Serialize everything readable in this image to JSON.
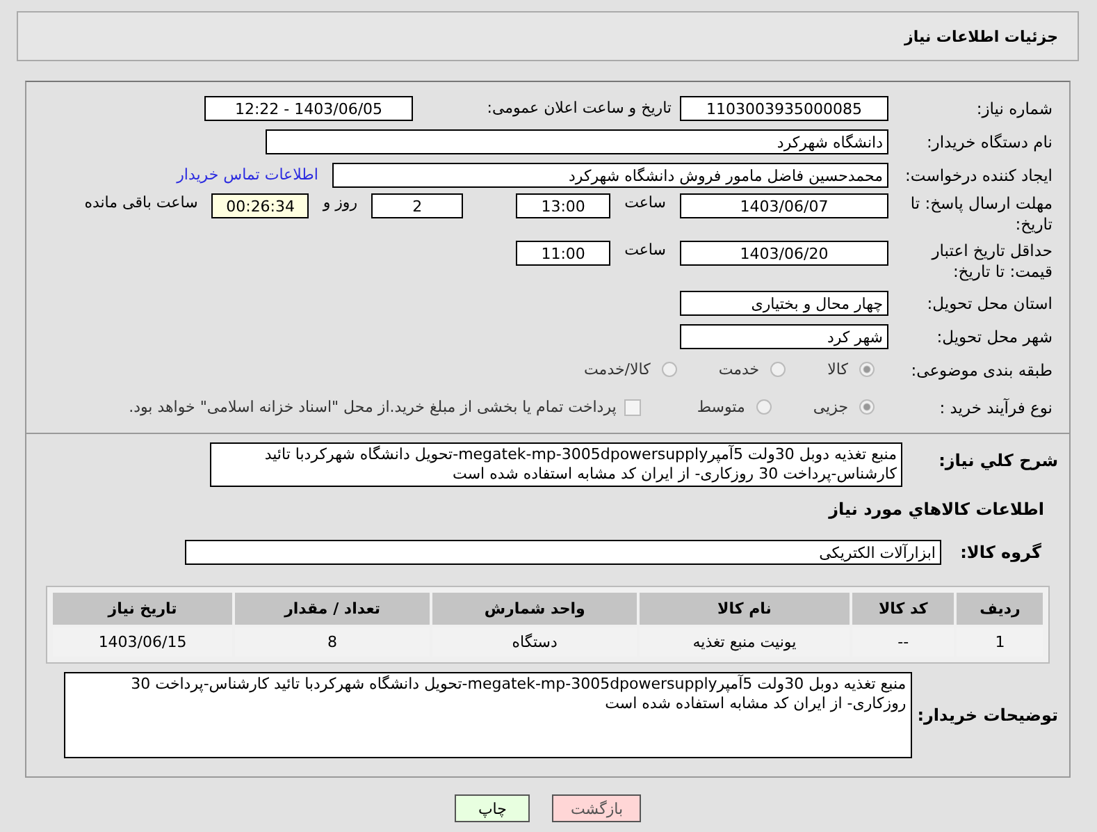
{
  "header": {
    "title": "جزئیات اطلاعات نیاز"
  },
  "need_number": {
    "label": "شماره نیاز:",
    "value": "1103003935000085"
  },
  "announce": {
    "label": "تاریخ و ساعت اعلان عمومی:",
    "value": "1403/06/05 - 12:22"
  },
  "buyer_org": {
    "label": "نام دستگاه خریدار:",
    "value": "دانشگاه شهرکرد"
  },
  "requester": {
    "label": "ایجاد کننده درخواست:",
    "value": "محمدحسین فاضل مامور فروش دانشگاه شهرکرد",
    "link": "اطلاعات تماس خریدار"
  },
  "reply_deadline": {
    "label": "مهلت ارسال پاسخ: تا تاریخ:",
    "date": "1403/06/07",
    "time_label": "ساعت",
    "time": "13:00",
    "days": "2",
    "days_label": "روز و",
    "remaining": "00:26:34",
    "remaining_label": "ساعت باقی مانده"
  },
  "price_validity": {
    "label": "حداقل تاریخ اعتبار قیمت: تا تاریخ:",
    "date": "1403/06/20",
    "time_label": "ساعت",
    "time": "11:00"
  },
  "province": {
    "label": "استان محل تحویل:",
    "value": "چهار محال و بختیاری"
  },
  "city": {
    "label": "شهر محل تحویل:",
    "value": "شهر کرد"
  },
  "category": {
    "label": "طبقه بندی موضوعی:",
    "options": [
      {
        "label": "کالا",
        "selected": true
      },
      {
        "label": "خدمت",
        "selected": false
      },
      {
        "label": "کالا/خدمت",
        "selected": false
      }
    ]
  },
  "process": {
    "label": "نوع فرآیند خرید :",
    "options": [
      {
        "label": "جزیی",
        "selected": true
      },
      {
        "label": "متوسط",
        "selected": false
      }
    ],
    "payment": {
      "label": "پرداخت تمام یا بخشی از مبلغ خرید.از محل \"اسناد خزانه اسلامی\" خواهد بود.",
      "checked": false
    }
  },
  "description": {
    "label": "شرح کلي نیاز:",
    "value": "منبع تغذیه دوبل 30ولت 5آمپرmegatek-mp-3005dpowersupply-تحویل دانشگاه شهرکردبا تائید کارشناس-پرداخت 30 روزکاری- از ایران کد مشابه استفاده شده است"
  },
  "goods_heading": "اطلاعات کالاهاي مورد نياز",
  "goods_group": {
    "label": "گروه کالا:",
    "value": "ابزارآلات الکتریکی"
  },
  "table": {
    "columns": [
      "ردیف",
      "کد کالا",
      "نام کالا",
      "واحد شمارش",
      "تعداد / مقدار",
      "تاریخ نیاز"
    ],
    "rows": [
      [
        "1",
        "--",
        "یونیت منبع تغذیه",
        "دستگاه",
        "8",
        "1403/06/15"
      ]
    ]
  },
  "buyer_notes": {
    "label": "توضیحات خریدار:",
    "value": "منبع تغذیه دوبل 30ولت 5آمپرmegatek-mp-3005dpowersupply-تحویل دانشگاه شهرکردبا تائید کارشناس-پرداخت 30 روزکاری- از ایران کد مشابه استفاده شده است"
  },
  "buttons": [
    {
      "label": "بازگشت",
      "kind": "back"
    },
    {
      "label": "چاپ",
      "kind": "print"
    }
  ]
}
